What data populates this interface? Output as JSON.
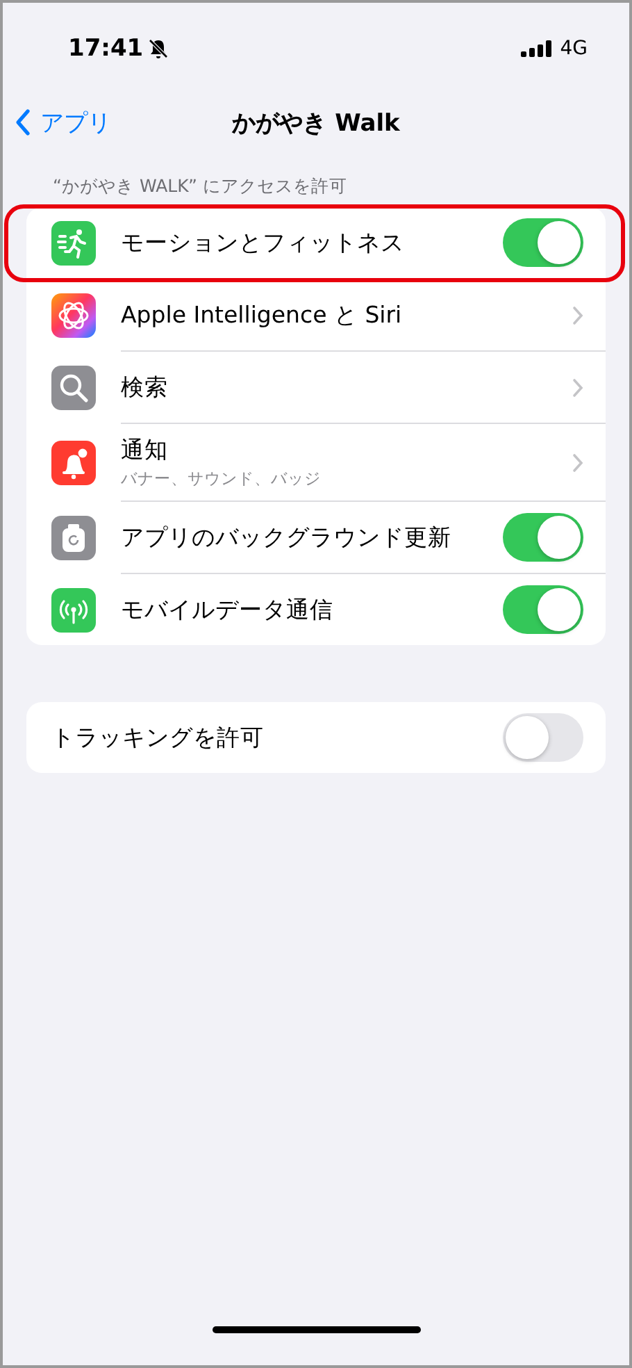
{
  "status_bar": {
    "time": "17:41",
    "silent": true,
    "network": "4G"
  },
  "nav": {
    "back": "アプリ",
    "title": "かがやき Walk"
  },
  "section_header": "“かがやき WALK” にアクセスを許可",
  "permissions": [
    {
      "label": "モーションとフィットネス",
      "kind": "toggle",
      "on": true,
      "highlighted": true
    },
    {
      "label": "Apple Intelligence と Siri",
      "kind": "link",
      "highlighted": false
    },
    {
      "label": "検索",
      "kind": "link",
      "highlighted": false
    },
    {
      "label": "通知",
      "subtitle": "バナー、サウンド、バッジ",
      "kind": "link",
      "highlighted": false
    },
    {
      "label": "アプリのバックグラウンド更新",
      "kind": "toggle",
      "on": true,
      "highlighted": false
    },
    {
      "label": "モバイルデータ通信",
      "kind": "toggle",
      "on": true,
      "highlighted": false
    }
  ],
  "tracking": {
    "label": "トラッキングを許可",
    "on": false
  }
}
